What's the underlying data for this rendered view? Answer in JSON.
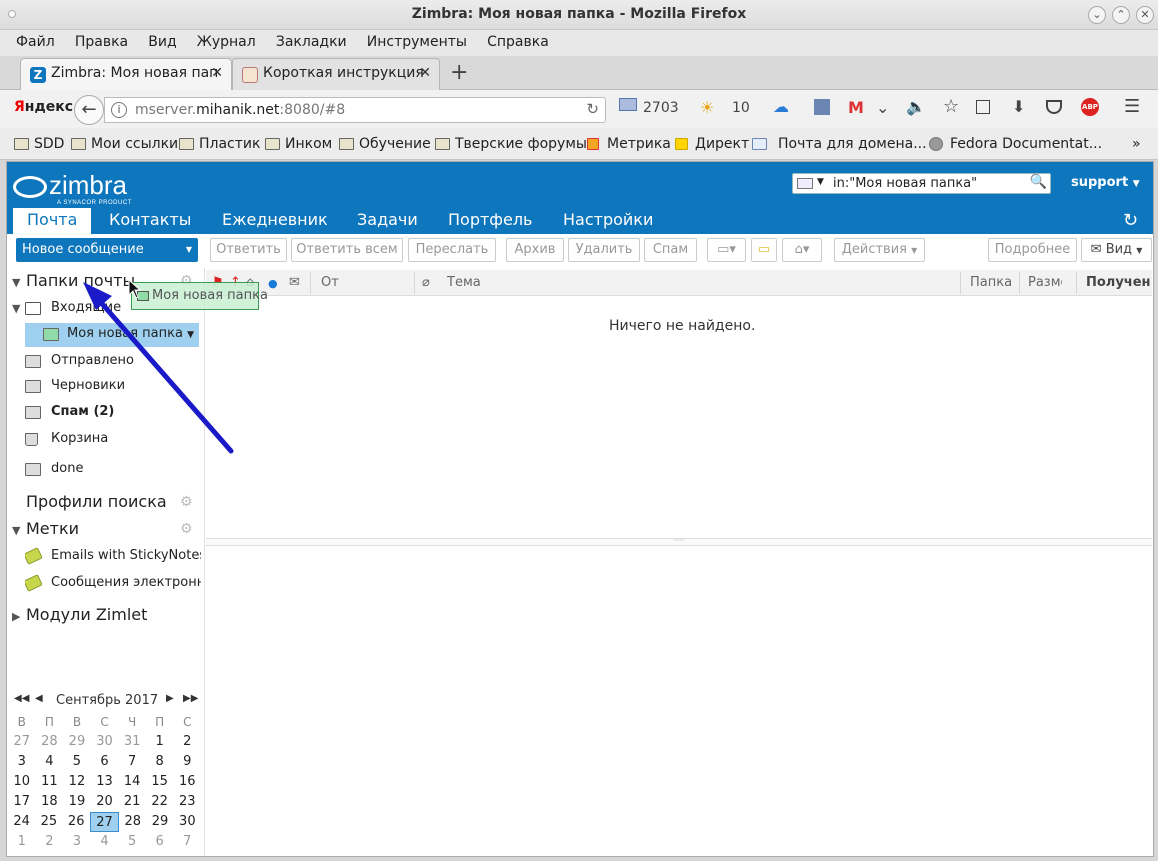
{
  "window": {
    "title": "Zimbra: Моя новая папка - Mozilla Firefox"
  },
  "menubar": [
    "Файл",
    "Правка",
    "Вид",
    "Журнал",
    "Закладки",
    "Инструменты",
    "Справка"
  ],
  "browser_tabs": [
    {
      "label": "Zimbra: Моя новая пап",
      "active": true
    },
    {
      "label": "Короткая инструкция",
      "active": false
    }
  ],
  "navbar": {
    "yandex_red": "Я",
    "yandex_rest": "ндекс",
    "url_prefix": "mserver.",
    "url_host": "mihanik.net",
    "url_suffix": ":8080/#8",
    "mail_count": "2703",
    "weather": "10"
  },
  "bookmarks": [
    "SDD",
    "Мои ссылки",
    "Пластик",
    "Инком",
    "Обучение",
    "Тверские форумы",
    "Метрика",
    "Директ",
    "Почта для домена...",
    "Fedora Documentat..."
  ],
  "zimbra": {
    "logo": "zimbra",
    "logo_sub": "A SYNACOR PRODUCT",
    "search_value": "in:\"Моя новая папка\"",
    "user": "support",
    "tabs": [
      "Почта",
      "Контакты",
      "Ежедневник",
      "Задачи",
      "Портфель",
      "Настройки"
    ],
    "active_tab": "Почта"
  },
  "toolbar": {
    "new_message": "Новое сообщение",
    "reply": "Ответить",
    "reply_all": "Ответить всем",
    "forward": "Переслать",
    "archive": "Архив",
    "delete": "Удалить",
    "spam": "Спам",
    "actions": "Действия",
    "details": "Подробнее",
    "view": "Вид"
  },
  "sidebar": {
    "mail_folders_title": "Папки почты",
    "folders": [
      {
        "label": "Входящие"
      },
      {
        "label": "Моя новая папка"
      },
      {
        "label": "Отправлено"
      },
      {
        "label": "Черновики"
      },
      {
        "label": "Спам (2)"
      },
      {
        "label": "Корзина"
      },
      {
        "label": "done"
      }
    ],
    "search_profiles_title": "Профили поиска",
    "tags_title": "Метки",
    "tags": [
      {
        "label": "Emails with StickyNotes"
      },
      {
        "label": "Сообщения электронно"
      }
    ],
    "zimlets_title": "Модули Zimlet"
  },
  "drag_ghost": "Моя новая папка",
  "list": {
    "col_from": "От",
    "col_subject": "Тема",
    "col_folder": "Папка",
    "col_size": "Разме",
    "col_received": "Получен",
    "empty_text": "Ничего не найдено."
  },
  "calendar": {
    "month": "Сентябрь 2017",
    "dow": [
      "В",
      "П",
      "В",
      "С",
      "Ч",
      "П",
      "С"
    ],
    "weeks": [
      [
        "27",
        "28",
        "29",
        "30",
        "31",
        "1",
        "2"
      ],
      [
        "3",
        "4",
        "5",
        "6",
        "7",
        "8",
        "9"
      ],
      [
        "10",
        "11",
        "12",
        "13",
        "14",
        "15",
        "16"
      ],
      [
        "17",
        "18",
        "19",
        "20",
        "21",
        "22",
        "23"
      ],
      [
        "24",
        "25",
        "26",
        "27",
        "28",
        "29",
        "30"
      ],
      [
        "1",
        "2",
        "3",
        "4",
        "5",
        "6",
        "7"
      ]
    ],
    "today": "27"
  },
  "colors": {
    "zimbra_blue": "#0e76bc",
    "selected_folder": "#9fd0ef",
    "annotation_arrow": "#1a1ac8"
  }
}
